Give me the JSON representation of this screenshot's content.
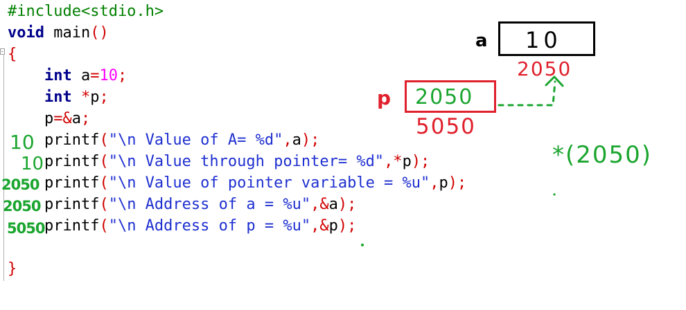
{
  "code": {
    "lines": [
      [
        {
          "t": "#include<stdio.h>",
          "c": "pp"
        }
      ],
      [
        {
          "t": "void",
          "c": "kw"
        },
        {
          "t": " main",
          "c": "pl"
        },
        {
          "t": "()",
          "c": "op"
        }
      ],
      [
        {
          "t": "{",
          "c": "op"
        }
      ],
      [
        {
          "t": "    ",
          "c": "pl"
        },
        {
          "t": "int",
          "c": "kw"
        },
        {
          "t": " a",
          "c": "pl"
        },
        {
          "t": "=",
          "c": "op"
        },
        {
          "t": "10",
          "c": "num"
        },
        {
          "t": ";",
          "c": "op"
        }
      ],
      [
        {
          "t": "    ",
          "c": "pl"
        },
        {
          "t": "int",
          "c": "kw"
        },
        {
          "t": " ",
          "c": "pl"
        },
        {
          "t": "*",
          "c": "op"
        },
        {
          "t": "p",
          "c": "pl"
        },
        {
          "t": ";",
          "c": "op"
        }
      ],
      [
        {
          "t": "    p",
          "c": "pl"
        },
        {
          "t": "=&",
          "c": "op"
        },
        {
          "t": "a",
          "c": "pl"
        },
        {
          "t": ";",
          "c": "op"
        }
      ],
      [
        {
          "t": "    printf",
          "c": "pl"
        },
        {
          "t": "(",
          "c": "op"
        },
        {
          "t": "\"\\n Value of A= %d\"",
          "c": "str"
        },
        {
          "t": ",",
          "c": "op"
        },
        {
          "t": "a",
          "c": "pl"
        },
        {
          "t": ");",
          "c": "op"
        }
      ],
      [
        {
          "t": "    printf",
          "c": "pl"
        },
        {
          "t": "(",
          "c": "op"
        },
        {
          "t": "\"\\n Value through pointer= %d\"",
          "c": "str"
        },
        {
          "t": ",*",
          "c": "op"
        },
        {
          "t": "p",
          "c": "pl"
        },
        {
          "t": ");",
          "c": "op"
        }
      ],
      [
        {
          "t": "    printf",
          "c": "pl"
        },
        {
          "t": "(",
          "c": "op"
        },
        {
          "t": "\"\\n Value of pointer variable = %u\"",
          "c": "str"
        },
        {
          "t": ",",
          "c": "op"
        },
        {
          "t": "p",
          "c": "pl"
        },
        {
          "t": ");",
          "c": "op"
        }
      ],
      [
        {
          "t": "    printf",
          "c": "pl"
        },
        {
          "t": "(",
          "c": "op"
        },
        {
          "t": "\"\\n Address of a = %u\"",
          "c": "str"
        },
        {
          "t": ",&",
          "c": "op"
        },
        {
          "t": "a",
          "c": "pl"
        },
        {
          "t": ");",
          "c": "op"
        }
      ],
      [
        {
          "t": "    printf",
          "c": "pl"
        },
        {
          "t": "(",
          "c": "op"
        },
        {
          "t": "\"\\n Address of p = %u\"",
          "c": "str"
        },
        {
          "t": ",&",
          "c": "op"
        },
        {
          "t": "p",
          "c": "pl"
        },
        {
          "t": ");",
          "c": "op"
        }
      ],
      [
        {
          "t": "",
          "c": "pl"
        }
      ],
      [
        {
          "t": "}",
          "c": "op"
        }
      ]
    ]
  },
  "annotations": {
    "margin_outputs": [
      "10",
      "10",
      "2050",
      "2050",
      "5050"
    ],
    "var_a": {
      "label": "a",
      "value": "10",
      "address": "2050"
    },
    "var_p": {
      "label": "p",
      "value": "2050",
      "address": "5050"
    },
    "deref_note": "*(2050)"
  },
  "colors": {
    "handwriting_green": "#1aa52e",
    "handwriting_red": "#e0202c",
    "box_red": "#e0202c",
    "box_black": "#000000"
  }
}
